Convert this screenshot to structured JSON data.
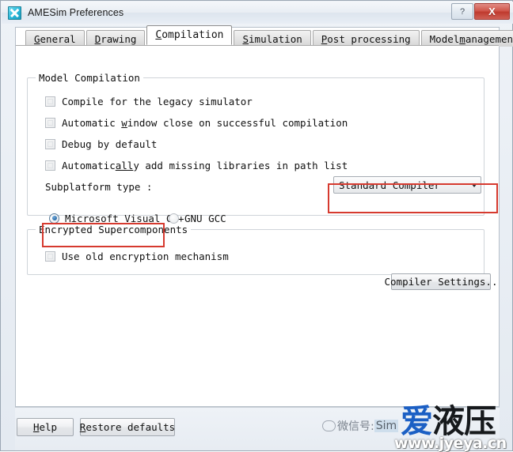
{
  "window": {
    "title": "AMESim Preferences",
    "app_icon": "amesim-x-icon",
    "buttons": {
      "help_glyph": "?",
      "close_glyph": "X"
    }
  },
  "tabs": [
    {
      "label": "General",
      "mnemonic_pre": "",
      "mnemonic": "G",
      "mnemonic_post": "eneral",
      "active": false
    },
    {
      "label": "Drawing",
      "mnemonic_pre": "",
      "mnemonic": "D",
      "mnemonic_post": "rawing",
      "active": false
    },
    {
      "label": "Compilation",
      "mnemonic_pre": "",
      "mnemonic": "C",
      "mnemonic_post": "ompilation",
      "active": true
    },
    {
      "label": "Simulation",
      "mnemonic_pre": "",
      "mnemonic": "S",
      "mnemonic_post": "imulation",
      "active": false
    },
    {
      "label": "Post processing",
      "mnemonic_pre": "",
      "mnemonic": "P",
      "mnemonic_post": "ost processing",
      "active": false
    },
    {
      "label": "Model management",
      "mnemonic_pre": "Model ",
      "mnemonic": "m",
      "mnemonic_post": "anagement",
      "active": false
    }
  ],
  "model_compilation": {
    "group_title": "Model Compilation",
    "checkboxes": [
      {
        "pre": "Compile for the legacy simulator",
        "mnemonic": "",
        "post": "",
        "checked": false
      },
      {
        "pre": "Automatic ",
        "mnemonic": "w",
        "post": "indow close on successful compilation",
        "checked": false
      },
      {
        "pre": "Debug by default",
        "mnemonic": "",
        "post": "",
        "checked": false
      },
      {
        "pre": "Automatic",
        "mnemonic": "all",
        "post": "y add missing libraries in path list",
        "checked": false
      }
    ],
    "subplatform_label": "Subplatform type :",
    "subplatform_value": "Standard Compiler",
    "subplatform_options": [
      "Standard Compiler"
    ],
    "compiler_radios": [
      {
        "label": "Microsoft Visual C++",
        "selected": true
      },
      {
        "label": "GNU GCC",
        "selected": false
      }
    ]
  },
  "encrypted_supercomponents": {
    "group_title": "Encrypted Supercomponents",
    "checkbox": {
      "label": "Use old encryption mechanism",
      "checked": false
    },
    "settings_button": "Compiler Settings.."
  },
  "footer": {
    "help": {
      "pre": "",
      "mnemonic": "H",
      "post": "elp"
    },
    "restore": {
      "pre": "",
      "mnemonic": "R",
      "post": "estore defaults"
    }
  },
  "annotations": {
    "accent_color": "#d63a2f",
    "boxes": [
      "subplatform-combo",
      "microsoft-visual-cpp-radio"
    ]
  },
  "watermark": {
    "wechat_prefix": "微信号:",
    "wechat_id": "Sim",
    "brand_blue": "爱",
    "brand_black": "液压",
    "url": "www.jyeya.cn"
  }
}
